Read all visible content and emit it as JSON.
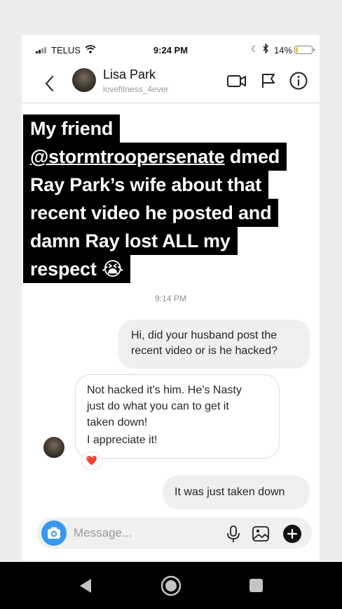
{
  "status_bar": {
    "carrier": "TELUS",
    "time": "9:24 PM",
    "battery_percent": "14%",
    "battery_level": 0.14,
    "battery_color": "#f2c230",
    "icons": [
      "signal-icon",
      "wifi-icon",
      "moon-icon",
      "bluetooth-icon",
      "battery-icon"
    ]
  },
  "header": {
    "name": "Lisa Park",
    "username": "lovefitness_4ever",
    "icons": [
      "back-icon",
      "video-call-icon",
      "flag-icon",
      "info-icon"
    ]
  },
  "caption": {
    "line1": "My friend",
    "line2_mention": "@stormtroopersenate",
    "line2_rest": " dmed",
    "line3": "Ray Park’s wife about that",
    "line4": "recent video he posted and",
    "line5": "damn Ray lost ALL my",
    "line6": "respect 😭"
  },
  "thread": {
    "timestamp": "9:14 PM",
    "messages": [
      {
        "from": "me",
        "lines": [
          "Hi, did your husband post the",
          "recent video or is he hacked?"
        ]
      },
      {
        "from": "them",
        "lines": [
          "Not hacked it’s him.  He’s Nasty",
          "just do what you can to get it",
          "taken down!",
          "I appreciate it!"
        ],
        "reaction": "❤️"
      },
      {
        "from": "me",
        "lines": [
          "It was just taken down"
        ]
      }
    ]
  },
  "composer": {
    "placeholder": "Message...",
    "icons": [
      "camera-icon",
      "microphone-icon",
      "gallery-icon",
      "add-icon"
    ]
  },
  "navbar": {
    "icons": [
      "nav-back-icon",
      "nav-home-icon",
      "nav-recents-icon"
    ]
  },
  "colors": {
    "accent": "#3897f0",
    "caption_bg": "#000000",
    "outgoing_bubble": "#efefef",
    "incoming_border": "#dbdbdb"
  }
}
